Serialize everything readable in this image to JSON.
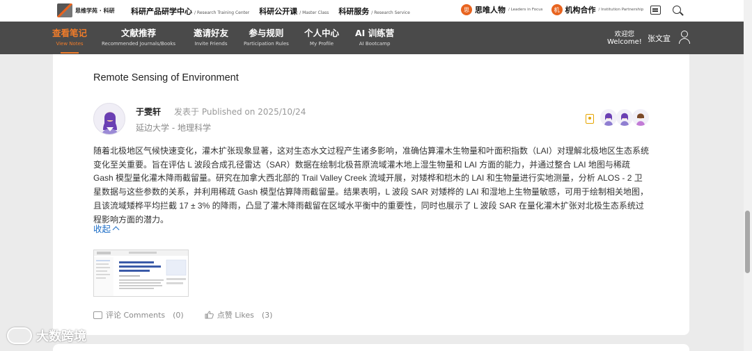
{
  "brand": {
    "logo_text": "思维学苑 · 科研"
  },
  "top_nav": [
    {
      "cn": "科研产品研学中心",
      "en": "/ Research Training Center"
    },
    {
      "cn": "科研公开课",
      "en": "/ Master Class"
    },
    {
      "cn": "科研服务",
      "en": "/ Research Service"
    }
  ],
  "top_right": [
    {
      "badge": "思",
      "cn": "思唯人物",
      "en": "/ Leaders in Focus"
    },
    {
      "badge": "机",
      "cn": "机构合作",
      "en": "/ Institution Partnership"
    }
  ],
  "main_nav": [
    {
      "cn": "查看笔记",
      "en": "View Notes",
      "active": true
    },
    {
      "cn": "文献推荐",
      "en": "Recommended Journals/Books"
    },
    {
      "cn": "邀请好友",
      "en": "Invite Friends"
    },
    {
      "cn": "参与规则",
      "en": "Participation Rules"
    },
    {
      "cn": "个人中心",
      "en": "My Profile"
    },
    {
      "cn": "AI 训练营",
      "en": "AI Bootcamp"
    }
  ],
  "user": {
    "welcome_cn": "欢迎您",
    "welcome_en": "Welcome!",
    "name": "张文宜"
  },
  "ghost": {
    "comments": "评论 Comments  (0)",
    "likes": "点赞 Likes  (3)"
  },
  "post": {
    "journal": "Remote Sensing of Environment",
    "author": "于雯轩",
    "posted": "发表于 Published on 2025/10/24",
    "affiliation": "延边大学 - 地理科学",
    "body": "随着北极地区气候快速变化，灌木扩张现象显著，这对生态水文过程产生诸多影响，准确估算灌木生物量和叶面积指数（LAI）对理解北极地区生态系统变化至关重要。旨在评估 L 波段合成孔径雷达（SAR）数据在绘制北极苔原流域灌木地上湿生物量和 LAI 方面的能力，并通过整合 LAI 地图与稀疏 Gash 模型量化灌木降雨截留量。研究在加拿大西北部的 Trail Valley Creek 流域开展，对矮桦和桤木的 LAI 和生物量进行实地测量，分析 ALOS - 2 卫星数据与这些参数的关系，并利用稀疏 Gash 模型估算降雨截留量。结果表明，L 波段 SAR 对矮桦的 LAI 和湿地上生物量敏感，可用于绘制相关地图，且该流域矮桦平均拦截 17 ± 3% 的降雨，凸显了灌木降雨截留在区域水平衡中的重要性，同时也展示了 L 波段 SAR 在量化灌木扩张对北极生态系统过程影响方面的潜力。",
    "collapse_label": "收起",
    "comments_label": "评论 Comments",
    "comments_count": "(0)",
    "likes_label": "点赞 Likes",
    "likes_count": "(3)"
  },
  "watermark": "大数跨境",
  "colors": {
    "accent": "#f07c2a",
    "nav_bg": "#4a4a4a",
    "link": "#1f6fc7"
  }
}
